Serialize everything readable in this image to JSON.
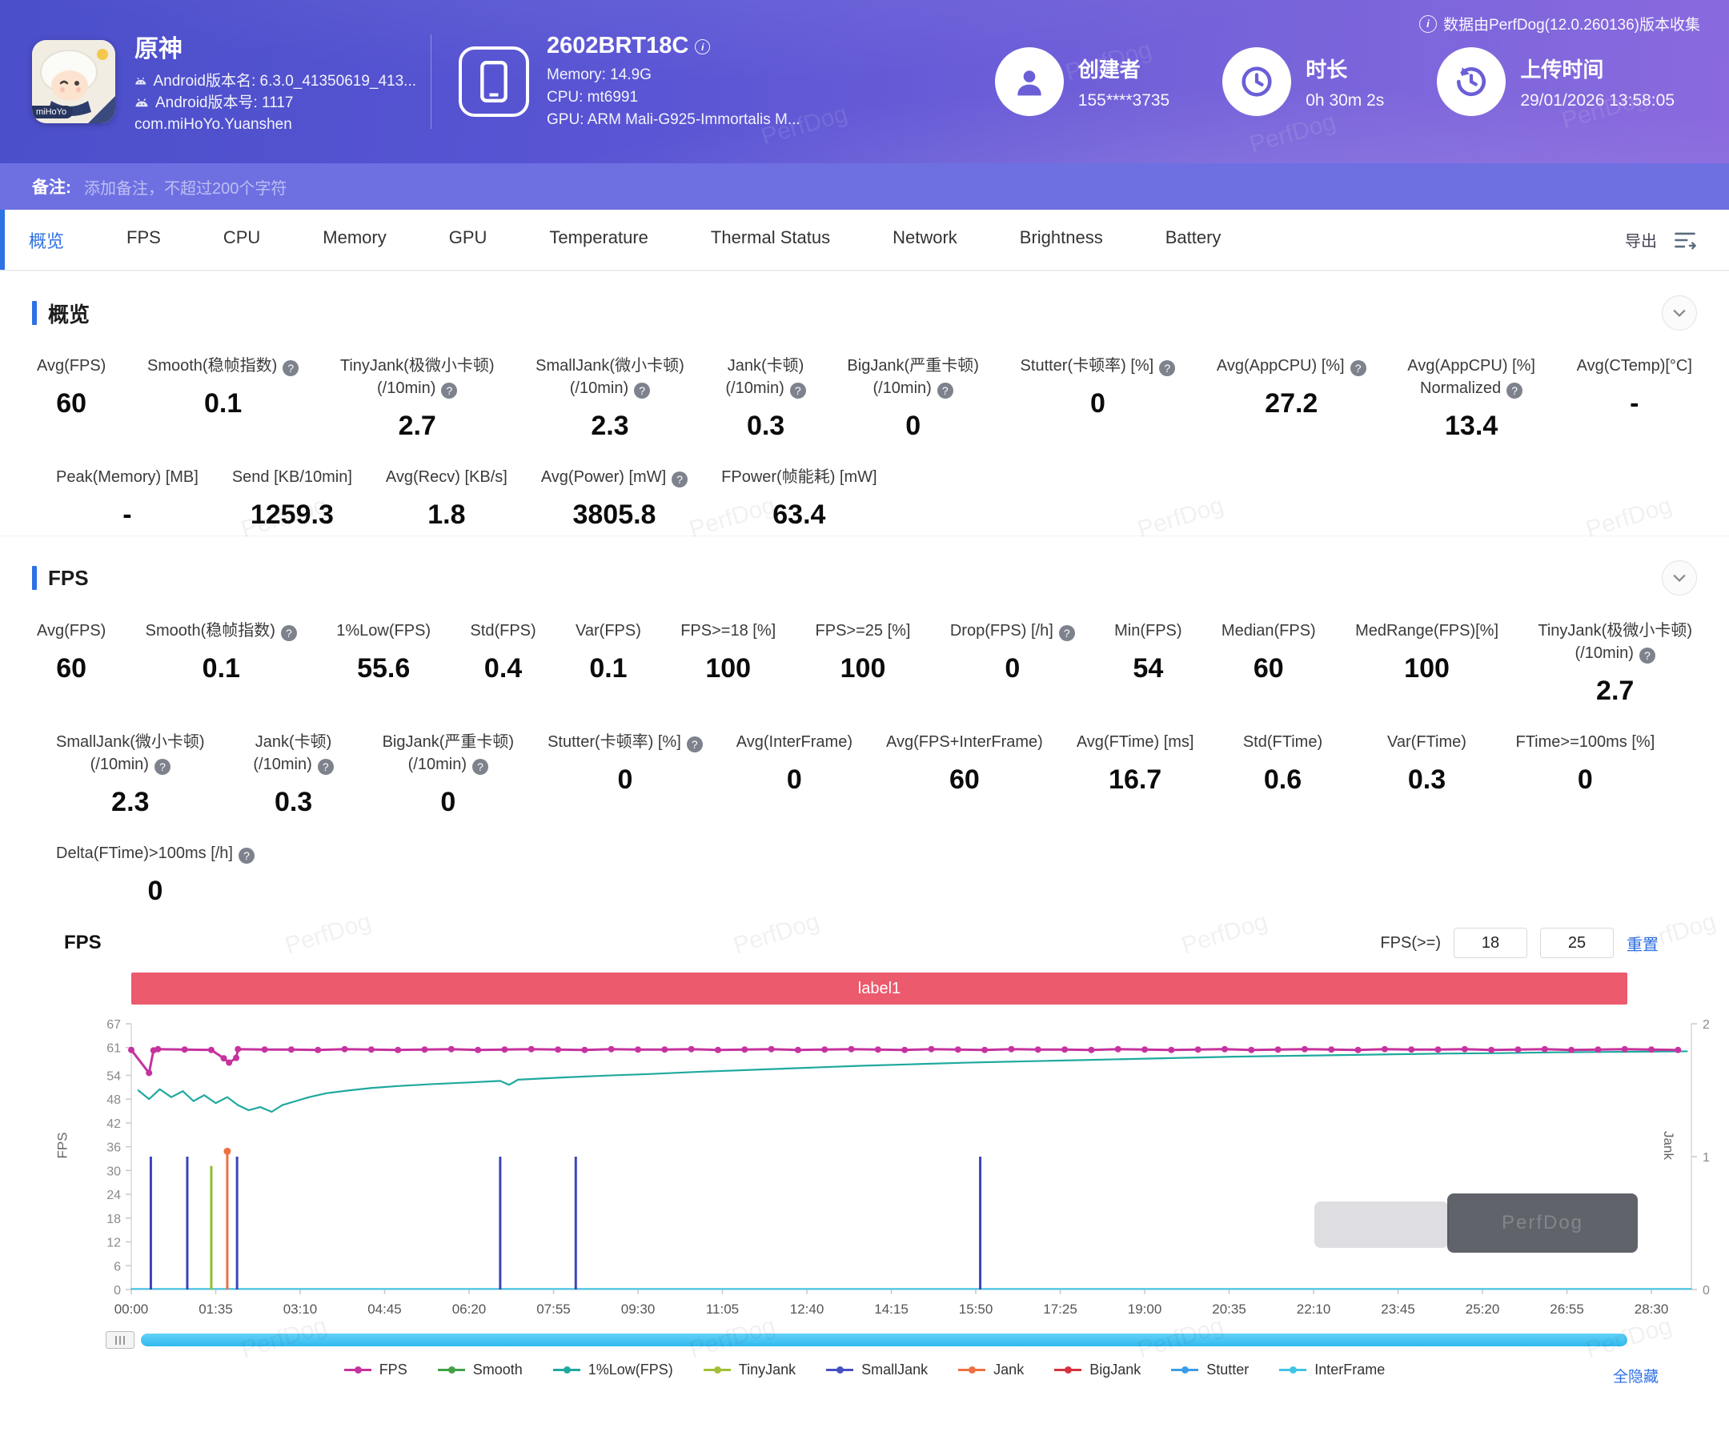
{
  "header": {
    "collect_note": "数据由PerfDog(12.0.260136)版本收集",
    "app": {
      "name": "原神",
      "line1": "Android版本名: 6.3.0_41350619_413...",
      "line2": "Android版本号: 1117",
      "package": "com.miHoYo.Yuanshen",
      "badge": "miHoYo"
    },
    "device": {
      "name": "2602BRT18C",
      "memory": "Memory: 14.9G",
      "cpu": "CPU: mt6991",
      "gpu": "GPU: ARM Mali-G925-Immortalis M..."
    },
    "creator": {
      "label": "创建者",
      "value": "155****3735"
    },
    "duration": {
      "label": "时长",
      "value": "0h 30m 2s"
    },
    "upload": {
      "label": "上传时间",
      "value": "29/01/2026 13:58:05"
    }
  },
  "note_bar": {
    "label": "备注:",
    "placeholder": "添加备注，不超过200个字符"
  },
  "nav": {
    "tabs": [
      {
        "label": "概览",
        "active": true
      },
      {
        "label": "FPS",
        "active": false
      },
      {
        "label": "CPU",
        "active": false
      },
      {
        "label": "Memory",
        "active": false
      },
      {
        "label": "GPU",
        "active": false
      },
      {
        "label": "Temperature",
        "active": false
      },
      {
        "label": "Thermal Status",
        "active": false
      },
      {
        "label": "Network",
        "active": false
      },
      {
        "label": "Brightness",
        "active": false
      },
      {
        "label": "Battery",
        "active": false
      }
    ],
    "export_label": "导出"
  },
  "overview": {
    "title": "概览",
    "rows": [
      {
        "layout": "spread",
        "cells": [
          {
            "label": "Avg(FPS)",
            "value": "60"
          },
          {
            "label": "Smooth(稳帧指数)",
            "help": true,
            "value": "0.1"
          },
          {
            "label": "TinyJank(极微小卡顿)",
            "sub": "(/10min)",
            "help": true,
            "value": "2.7"
          },
          {
            "label": "SmallJank(微小卡顿)",
            "sub": "(/10min)",
            "help": true,
            "value": "2.3"
          },
          {
            "label": "Jank(卡顿)",
            "sub": "(/10min)",
            "help": true,
            "value": "0.3"
          },
          {
            "label": "BigJank(严重卡顿)",
            "sub": "(/10min)",
            "help": true,
            "value": "0"
          },
          {
            "label": "Stutter(卡顿率) [%]",
            "help": true,
            "value": "0"
          },
          {
            "label": "Avg(AppCPU) [%]",
            "help": true,
            "value": "27.2"
          },
          {
            "label": "Avg(AppCPU) [%]",
            "sub": "Normalized",
            "help": true,
            "value": "13.4"
          },
          {
            "label": "Avg(CTemp)[°C]",
            "value": "-"
          }
        ]
      },
      {
        "layout": "left",
        "cells": [
          {
            "label": "Peak(Memory) [MB]",
            "value": "-"
          },
          {
            "label": "Send [KB/10min]",
            "value": "1259.3"
          },
          {
            "label": "Avg(Recv) [KB/s]",
            "value": "1.8"
          },
          {
            "label": "Avg(Power) [mW]",
            "help": true,
            "value": "3805.8"
          },
          {
            "label": "FPower(帧能耗) [mW]",
            "value": "63.4"
          }
        ]
      }
    ]
  },
  "fps_section": {
    "title": "FPS",
    "rows": [
      {
        "layout": "spread",
        "cells": [
          {
            "label": "Avg(FPS)",
            "value": "60"
          },
          {
            "label": "Smooth(稳帧指数)",
            "help": true,
            "value": "0.1"
          },
          {
            "label": "1%Low(FPS)",
            "value": "55.6"
          },
          {
            "label": "Std(FPS)",
            "value": "0.4"
          },
          {
            "label": "Var(FPS)",
            "value": "0.1"
          },
          {
            "label": "FPS>=18 [%]",
            "value": "100"
          },
          {
            "label": "FPS>=25 [%]",
            "value": "100"
          },
          {
            "label": "Drop(FPS) [/h]",
            "help": true,
            "value": "0"
          },
          {
            "label": "Min(FPS)",
            "value": "54"
          },
          {
            "label": "Median(FPS)",
            "value": "60"
          },
          {
            "label": "MedRange(FPS)[%]",
            "value": "100"
          },
          {
            "label": "TinyJank(极微小卡顿)",
            "sub": "(/10min)",
            "help": true,
            "value": "2.7"
          }
        ]
      },
      {
        "layout": "left",
        "cells": [
          {
            "label": "SmallJank(微小卡顿)",
            "sub": "(/10min)",
            "help": true,
            "value": "2.3"
          },
          {
            "label": "Jank(卡顿)",
            "sub": "(/10min)",
            "help": true,
            "value": "0.3"
          },
          {
            "label": "BigJank(严重卡顿)",
            "sub": "(/10min)",
            "help": true,
            "value": "0"
          },
          {
            "label": "Stutter(卡顿率) [%]",
            "help": true,
            "value": "0"
          },
          {
            "label": "Avg(InterFrame)",
            "value": "0"
          },
          {
            "label": "Avg(FPS+InterFrame)",
            "value": "60"
          },
          {
            "label": "Avg(FTime) [ms]",
            "value": "16.7"
          },
          {
            "label": "Std(FTime)",
            "value": "0.6"
          },
          {
            "label": "Var(FTime)",
            "value": "0.3"
          },
          {
            "label": "FTime>=100ms [%]",
            "value": "0"
          }
        ]
      },
      {
        "layout": "left",
        "cells": [
          {
            "label": "Delta(FTime)>100ms [/h]",
            "help": true,
            "value": "0"
          }
        ]
      }
    ]
  },
  "chart": {
    "title": "FPS",
    "threshold_label": "FPS(>=)",
    "threshold1": "18",
    "threshold2": "25",
    "reset_label": "重置",
    "banner": "label1",
    "ylabel_left": "FPS",
    "ylabel_right": "Jank",
    "hide_all_label": "全隐藏",
    "legend": [
      {
        "name": "FPS",
        "color": "#c6329f"
      },
      {
        "name": "Smooth",
        "color": "#43a047"
      },
      {
        "name": "1%Low(FPS)",
        "color": "#1fa99e"
      },
      {
        "name": "TinyJank",
        "color": "#a2c037"
      },
      {
        "name": "SmallJank",
        "color": "#4550c2"
      },
      {
        "name": "Jank",
        "color": "#ef7043"
      },
      {
        "name": "BigJank",
        "color": "#d5323f"
      },
      {
        "name": "Stutter",
        "color": "#3b9de8"
      },
      {
        "name": "InterFrame",
        "color": "#40c4e6"
      }
    ]
  },
  "chart_data": {
    "type": "line",
    "title": "FPS",
    "x_max": 1755,
    "x_ticks": [
      "00:00",
      "01:35",
      "03:10",
      "04:45",
      "06:20",
      "07:55",
      "09:30",
      "11:05",
      "12:40",
      "14:15",
      "15:50",
      "17:25",
      "19:00",
      "20:35",
      "22:10",
      "23:45",
      "25:20",
      "26:55",
      "28:30"
    ],
    "x_tick_seconds": [
      0,
      95,
      190,
      285,
      380,
      475,
      570,
      665,
      760,
      855,
      950,
      1045,
      1140,
      1235,
      1330,
      1425,
      1520,
      1615,
      1710
    ],
    "y_left": {
      "label": "FPS",
      "max": 67,
      "ticks": [
        0,
        6,
        12,
        18,
        24,
        30,
        36,
        42,
        48,
        54,
        61,
        67
      ]
    },
    "y_right": {
      "label": "Jank",
      "max": 2,
      "ticks": [
        0,
        1,
        2
      ]
    },
    "series": [
      {
        "name": "InterFrame",
        "color": "#40c4e6",
        "axis": "left",
        "width": 2,
        "points": [
          [
            0,
            0.15
          ],
          [
            1755,
            0.15
          ]
        ]
      },
      {
        "name": "SmallJank",
        "color": "#3d44b8",
        "axis": "right",
        "type": "spike",
        "value": 1,
        "times": [
          22,
          63,
          119,
          415,
          500,
          955
        ]
      },
      {
        "name": "TinyJank",
        "color": "#8fbf2f",
        "axis": "right",
        "type": "spike",
        "value": 0.93,
        "times": [
          90
        ]
      },
      {
        "name": "Jank",
        "color": "#ef7043",
        "axis": "right",
        "type": "spike",
        "value": 1.04,
        "marker": true,
        "times": [
          108
        ]
      },
      {
        "name": "1%Low(FPS)",
        "color": "#1fa99e",
        "axis": "left",
        "width": 2.2,
        "points": [
          [
            8,
            50.2
          ],
          [
            20,
            48.0
          ],
          [
            32,
            50.5
          ],
          [
            45,
            48.5
          ],
          [
            58,
            50.0
          ],
          [
            70,
            47.5
          ],
          [
            82,
            49.0
          ],
          [
            95,
            47.0
          ],
          [
            108,
            48.5
          ],
          [
            120,
            46.5
          ],
          [
            132,
            45.2
          ],
          [
            145,
            46.0
          ],
          [
            158,
            44.8
          ],
          [
            170,
            46.5
          ],
          [
            185,
            47.5
          ],
          [
            200,
            48.5
          ],
          [
            220,
            49.5
          ],
          [
            245,
            50.2
          ],
          [
            270,
            50.8
          ],
          [
            300,
            51.3
          ],
          [
            340,
            51.8
          ],
          [
            380,
            52.2
          ],
          [
            415,
            52.6
          ],
          [
            425,
            51.6
          ],
          [
            435,
            52.9
          ],
          [
            480,
            53.4
          ],
          [
            530,
            53.9
          ],
          [
            580,
            54.3
          ],
          [
            640,
            54.9
          ],
          [
            700,
            55.4
          ],
          [
            760,
            55.9
          ],
          [
            820,
            56.4
          ],
          [
            880,
            56.8
          ],
          [
            940,
            57.2
          ],
          [
            1000,
            57.5
          ],
          [
            1060,
            57.8
          ],
          [
            1120,
            58.1
          ],
          [
            1180,
            58.4
          ],
          [
            1240,
            58.7
          ],
          [
            1300,
            58.9
          ],
          [
            1360,
            59.1
          ],
          [
            1420,
            59.3
          ],
          [
            1480,
            59.5
          ],
          [
            1540,
            59.6
          ],
          [
            1600,
            59.8
          ],
          [
            1660,
            59.9
          ],
          [
            1720,
            60.0
          ],
          [
            1750,
            60.05
          ]
        ]
      },
      {
        "name": "FPS",
        "color": "#c6329f",
        "axis": "left",
        "width": 3,
        "marker": true,
        "start": 0,
        "step": 30,
        "values": [
          60.4,
          60.6,
          60.5,
          60.4,
          60.6,
          60.5,
          60.5,
          60.4,
          60.6,
          60.5,
          60.4,
          60.5,
          60.6,
          60.4,
          60.5,
          60.6,
          60.5,
          60.4,
          60.6,
          60.5,
          60.5,
          60.6,
          60.4,
          60.5,
          60.6,
          60.4,
          60.5,
          60.6,
          60.5,
          60.4,
          60.6,
          60.5,
          60.4,
          60.6,
          60.5,
          60.5,
          60.4,
          60.6,
          60.5,
          60.4,
          60.5,
          60.6,
          60.4,
          60.5,
          60.6,
          60.5,
          60.4,
          60.6,
          60.5,
          60.5,
          60.6,
          60.4,
          60.5,
          60.6,
          60.4,
          60.5,
          60.6,
          60.5,
          60.4,
          60.6,
          60.5
        ],
        "extra": [
          [
            20,
            54.6
          ],
          [
            25,
            60.3
          ],
          [
            104,
            58.3
          ],
          [
            110,
            57.2
          ],
          [
            118,
            58.4
          ]
        ]
      }
    ]
  },
  "watermark": {
    "text": "PerfDog"
  }
}
